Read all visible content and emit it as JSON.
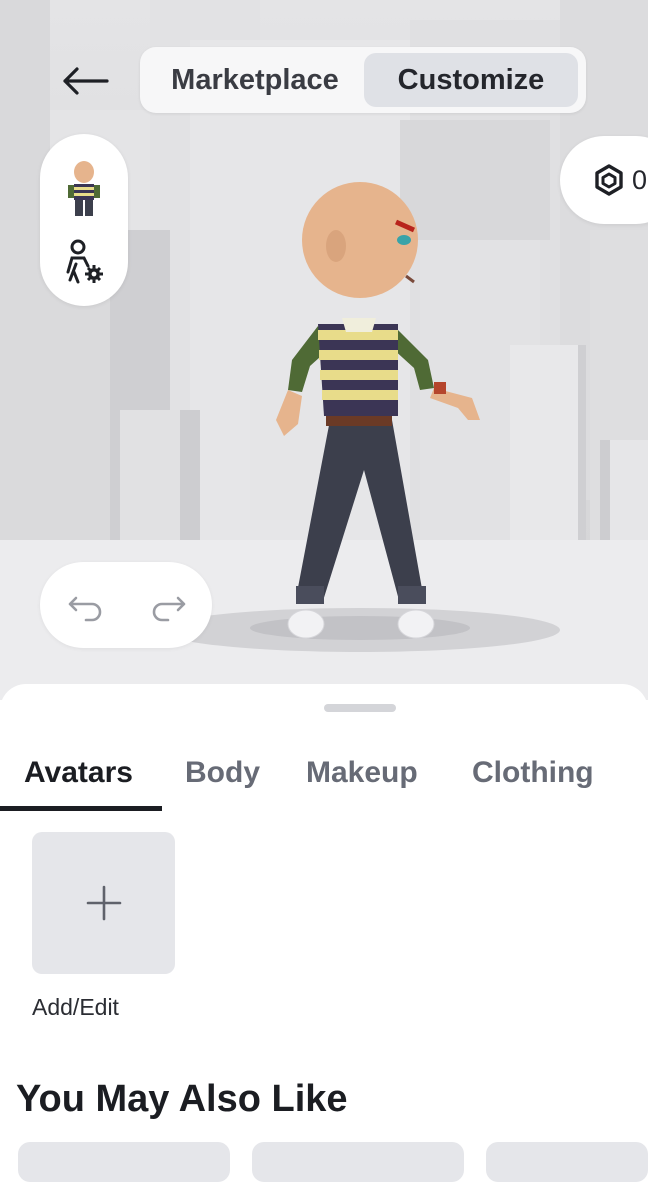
{
  "header": {
    "back_icon": "arrow-left-icon",
    "segments": [
      {
        "label": "Marketplace",
        "active": false
      },
      {
        "label": "Customize",
        "active": true
      }
    ]
  },
  "side_tools": {
    "avatar_icon": "avatar-thumbnail-icon",
    "settings_icon": "avatar-settings-icon"
  },
  "robux": {
    "icon": "robux-icon",
    "balance": "0"
  },
  "history": {
    "undo_icon": "undo-icon",
    "redo_icon": "redo-icon"
  },
  "sheet": {
    "tabs": [
      {
        "label": "Avatars",
        "active": true
      },
      {
        "label": "Body",
        "active": false
      },
      {
        "label": "Makeup",
        "active": false
      },
      {
        "label": "Clothing",
        "active": false
      }
    ],
    "add_tile": {
      "icon": "plus-icon",
      "label": "Add/Edit"
    },
    "recommend_title": "You May Also Like"
  },
  "colors": {
    "active_segment_bg": "#dfe1e6",
    "text_dark": "#1b1d22",
    "text_muted": "#676b76",
    "tile_bg": "#e5e6ea",
    "shirt_stripe_yellow": "#e8dc8a",
    "shirt_stripe_navy": "#3b3555",
    "sleeve_green": "#4f6a35",
    "jeans": "#3c3f4c",
    "skin": "#e6b48d"
  }
}
